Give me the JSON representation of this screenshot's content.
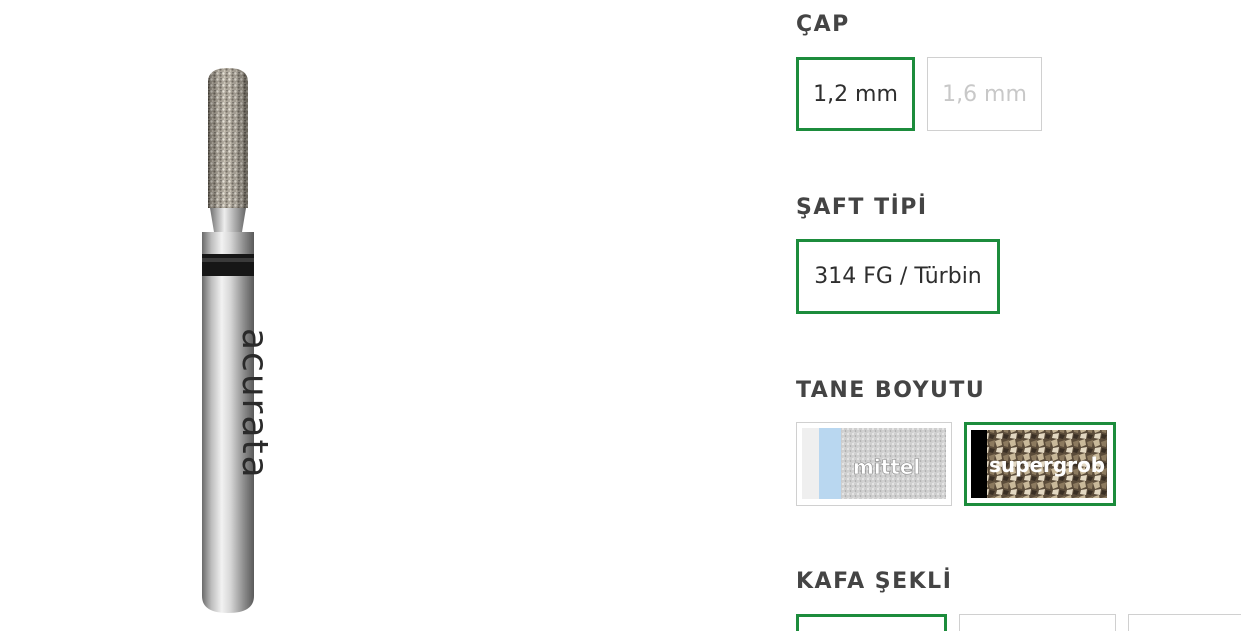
{
  "brand_text": "acurata",
  "options": {
    "cap": {
      "label": "ÇAP",
      "values": [
        "1,2 mm",
        "1,6 mm"
      ],
      "selected": "1,2 mm",
      "disabled": [
        "1,6 mm"
      ]
    },
    "saft_tipi": {
      "label": "ŞAFT TİPİ",
      "values": [
        "314 FG / Türbin"
      ],
      "selected": "314 FG / Türbin"
    },
    "tane_boyutu": {
      "label": "TANE BOYUTU",
      "values": [
        {
          "text": "mittel",
          "stripe_color": "#b9d7f0"
        },
        {
          "text": "supergrob",
          "stripe_color": "#000000"
        }
      ],
      "selected": "supergrob"
    },
    "kafa_sekli": {
      "label": "KAFA ŞEKLİ"
    }
  },
  "colors": {
    "selected_border": "#1c8c3c",
    "default_border": "#d0d0d0",
    "label_text": "#444444",
    "disabled_text": "#c8c8c8"
  }
}
